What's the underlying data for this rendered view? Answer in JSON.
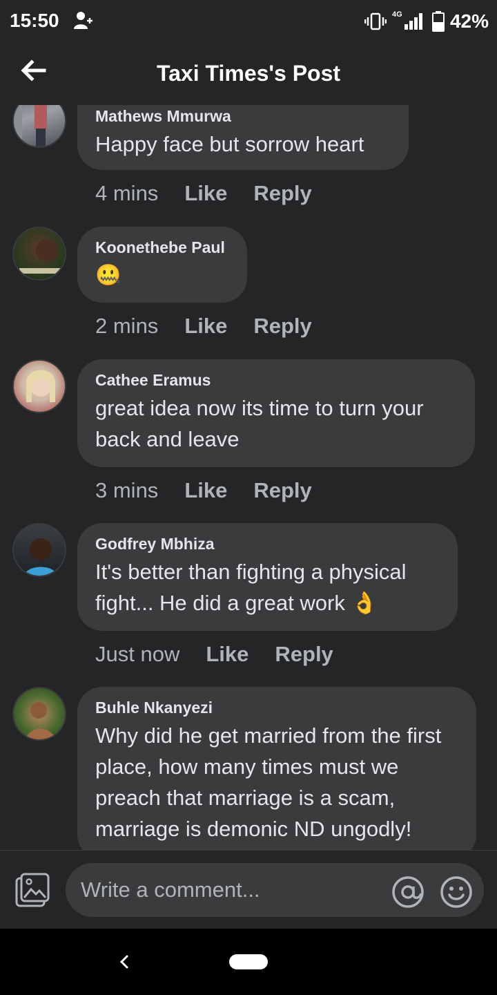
{
  "status_bar": {
    "time": "15:50",
    "network": "4G",
    "battery": "42%"
  },
  "header": {
    "title": "Taxi Times's Post"
  },
  "comments": [
    {
      "author": "Mathews Mmurwa",
      "text": "Happy face but sorrow heart",
      "time": "4 mins",
      "like": "Like",
      "reply": "Reply"
    },
    {
      "author": "Koonethebe Paul",
      "text": "🤐",
      "time": "2 mins",
      "like": "Like",
      "reply": "Reply"
    },
    {
      "author": "Cathee Eramus",
      "text": "great idea now its time to turn your back and leave",
      "time": "3 mins",
      "like": "Like",
      "reply": "Reply"
    },
    {
      "author": "Godfrey Mbhiza",
      "text": "It's better than fighting a physical fight... He did a great work 👌",
      "time": "Just now",
      "like": "Like",
      "reply": "Reply"
    },
    {
      "author": "Buhle Nkanyezi",
      "text": "Why did he get married from the first place, how many times must we preach that marriage is a scam, marriage is demonic ND ungodly!",
      "time": "",
      "like": "",
      "reply": ""
    }
  ],
  "composer": {
    "placeholder": "Write a comment..."
  },
  "icons": {
    "back": "arrow-left-icon",
    "photo": "photo-icon",
    "mention": "at-sign-icon",
    "emoji": "smiley-icon",
    "nav_back": "chevron-left-icon"
  },
  "colors": {
    "background": "#242527",
    "bubble": "#3a3b3c",
    "text": "#e4e6eb",
    "secondary_text": "#b0b3b8"
  }
}
